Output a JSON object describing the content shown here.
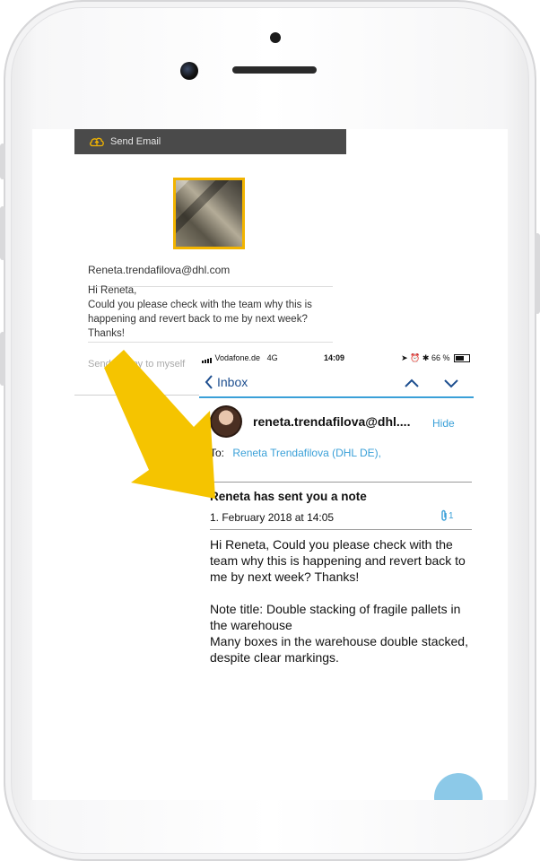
{
  "composer": {
    "send_label": "Send Email",
    "email": "Reneta.trendafilova@dhl.com",
    "body_lines": [
      "Hi Reneta,",
      "Could you please check with the team why this is",
      "happening and revert back to me by next week?",
      "Thanks!"
    ],
    "send_copy_label": "Send a copy to myself",
    "thumb_border_color": "#f2b400"
  },
  "mail": {
    "status": {
      "carrier": "Vodafone.de",
      "network": "4G",
      "time": "14:09",
      "battery": "66 %"
    },
    "nav": {
      "back_label": "Inbox"
    },
    "sender": "reneta.trendafilova@dhl....",
    "hide_label": "Hide",
    "to_label": "To:",
    "recipient": "Reneta Trendafilova (DHL DE),",
    "subject": "Reneta has sent you a note",
    "date": "1. February 2018 at 14:05",
    "attachment_count": "1",
    "body": [
      "Hi Reneta, Could you please check with the team why this is happening and revert back to me by next week? Thanks!",
      "Note title: Double stacking of fragile pallets in the warehouse",
      "Many boxes in the warehouse double stacked, despite clear markings."
    ],
    "accent_color": "#3aa0d8"
  },
  "annotation": {
    "arrow_color": "#f5c400"
  }
}
